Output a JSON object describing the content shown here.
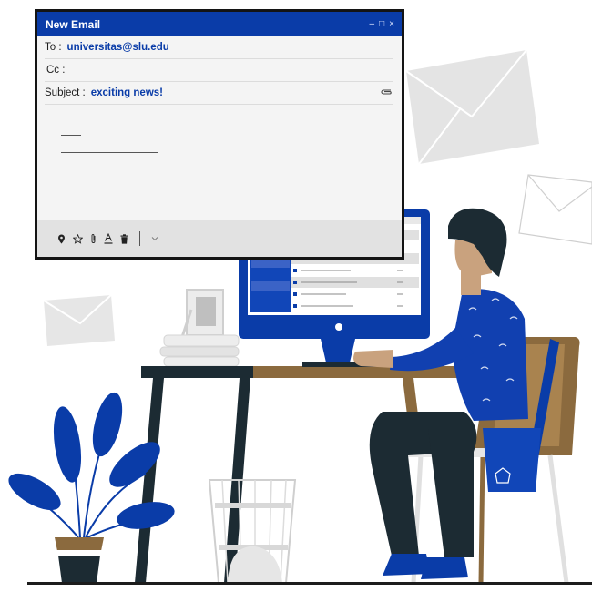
{
  "email": {
    "window_title": "New Email",
    "window_controls": [
      "–",
      "□",
      "×"
    ],
    "to_label": "To :",
    "to_value": "universitas@slu.edu",
    "cc_label": "Cc :",
    "cc_value": "",
    "subject_label": "Subject :",
    "subject_value": "exciting news!",
    "toolbar_icons": [
      "location-pin-icon",
      "star-icon",
      "paperclip-icon",
      "text-format-icon",
      "trash-icon",
      "chevron-down-icon"
    ]
  },
  "colors": {
    "brand_blue": "#0a3ca8",
    "wood_brown": "#8b6a3e",
    "dark_navy": "#1c2b33",
    "light_gray": "#e6e6e6"
  }
}
